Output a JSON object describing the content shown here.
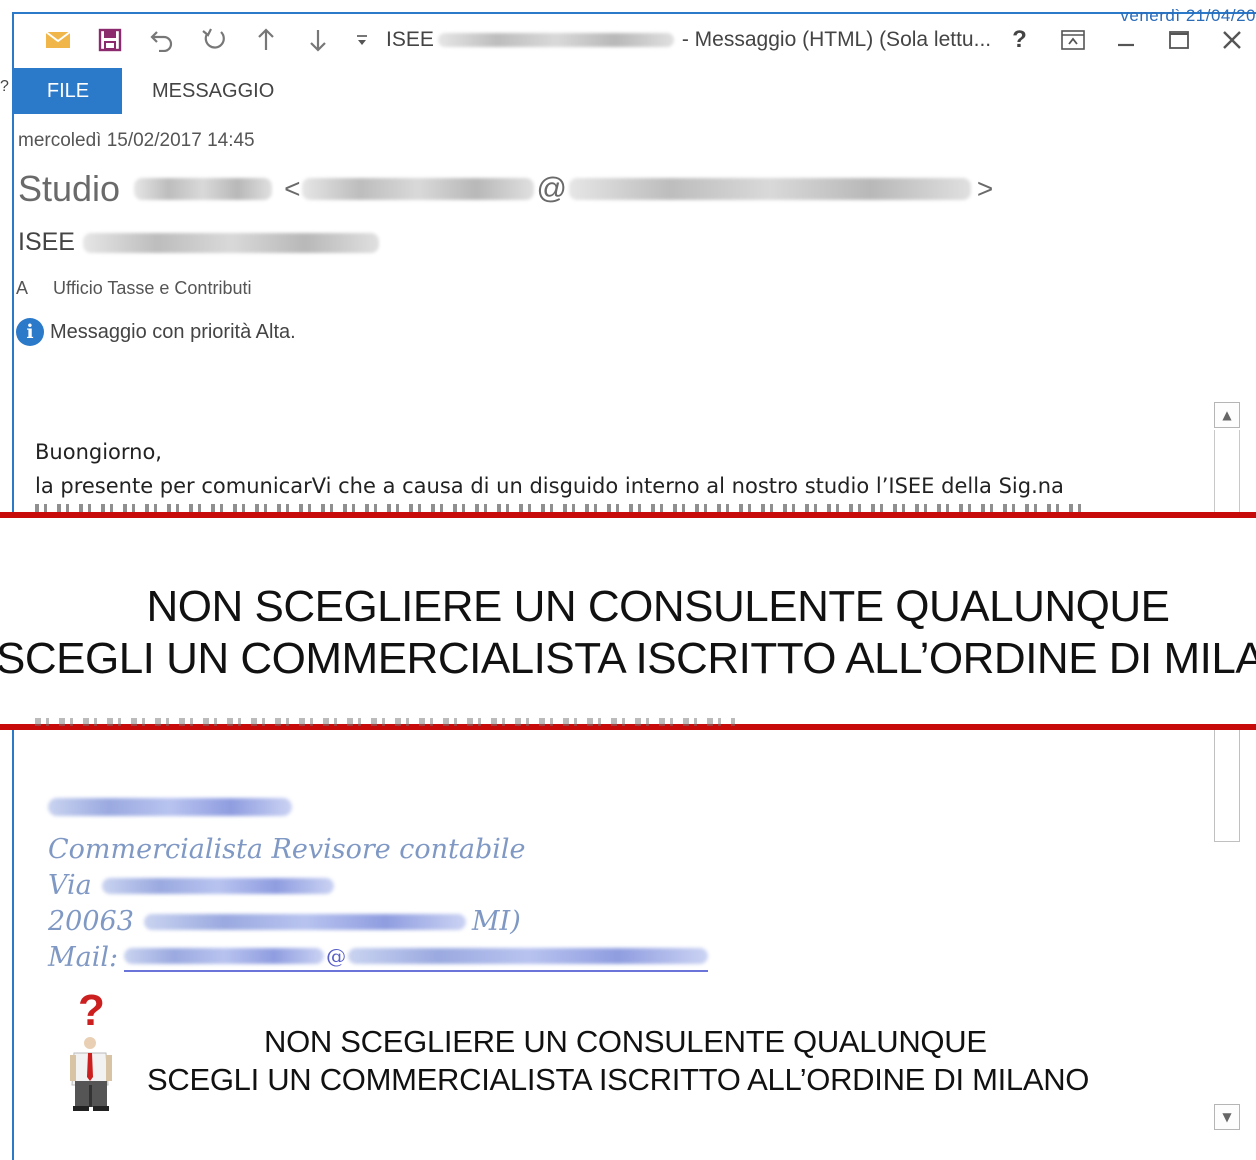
{
  "window": {
    "title_prefix": "ISEE",
    "title_suffix": "- Messaggio (HTML) (Sola lettu...",
    "top_edge_text": "venerdì 21/04/20",
    "controls": {
      "help": "?",
      "restore": "⧉",
      "minimize": "—",
      "maximize": "☐",
      "close": "✕"
    }
  },
  "quick_access": [
    "mail-icon",
    "save-icon",
    "undo-icon",
    "redo-icon",
    "previous-icon",
    "next-icon",
    "customize-icon"
  ],
  "ribbon": {
    "tabs": [
      "FILE",
      "MESSAGGIO"
    ],
    "active_tab": "FILE"
  },
  "header": {
    "date": "mercoledì 15/02/2017 14:45",
    "sender_name": "Studio",
    "sender_open": "<",
    "sender_at": "@",
    "sender_close": ">",
    "subject": "ISEE",
    "to_label": "A",
    "to_value": "Ufficio Tasse e Contributi",
    "info_icon": "i",
    "priority_text": "Messaggio con priorità Alta."
  },
  "body": {
    "greeting": "Buongiorno,",
    "line1": "la presente per comunicarVi che a causa di un disguido interno al nostro studio l’ISEE della Sig.na"
  },
  "banner": {
    "line1": "NON SCEGLIERE UN CONSULENTE QUALUNQUE",
    "line2": "SCEGLI UN COMMERCIALISTA ISCRITTO ALL’ORDINE DI MILA"
  },
  "signature": {
    "title": "Commercialista Revisore contabile",
    "street_label": "Via",
    "city_prefix": "20063",
    "city_suffix": "MI)",
    "mail_label": "Mail:",
    "mail_at": "@"
  },
  "footer": {
    "question_mark": "?",
    "line1": "NON SCEGLIERE UN CONSULENTE QUALUNQUE",
    "line2": "SCEGLI UN COMMERCIALISTA ISCRITTO ALL’ORDINE DI MILANO"
  },
  "colors": {
    "accent": "#2b79c9",
    "banner_rule": "#c70b0b",
    "signature": "#7f98c4"
  }
}
